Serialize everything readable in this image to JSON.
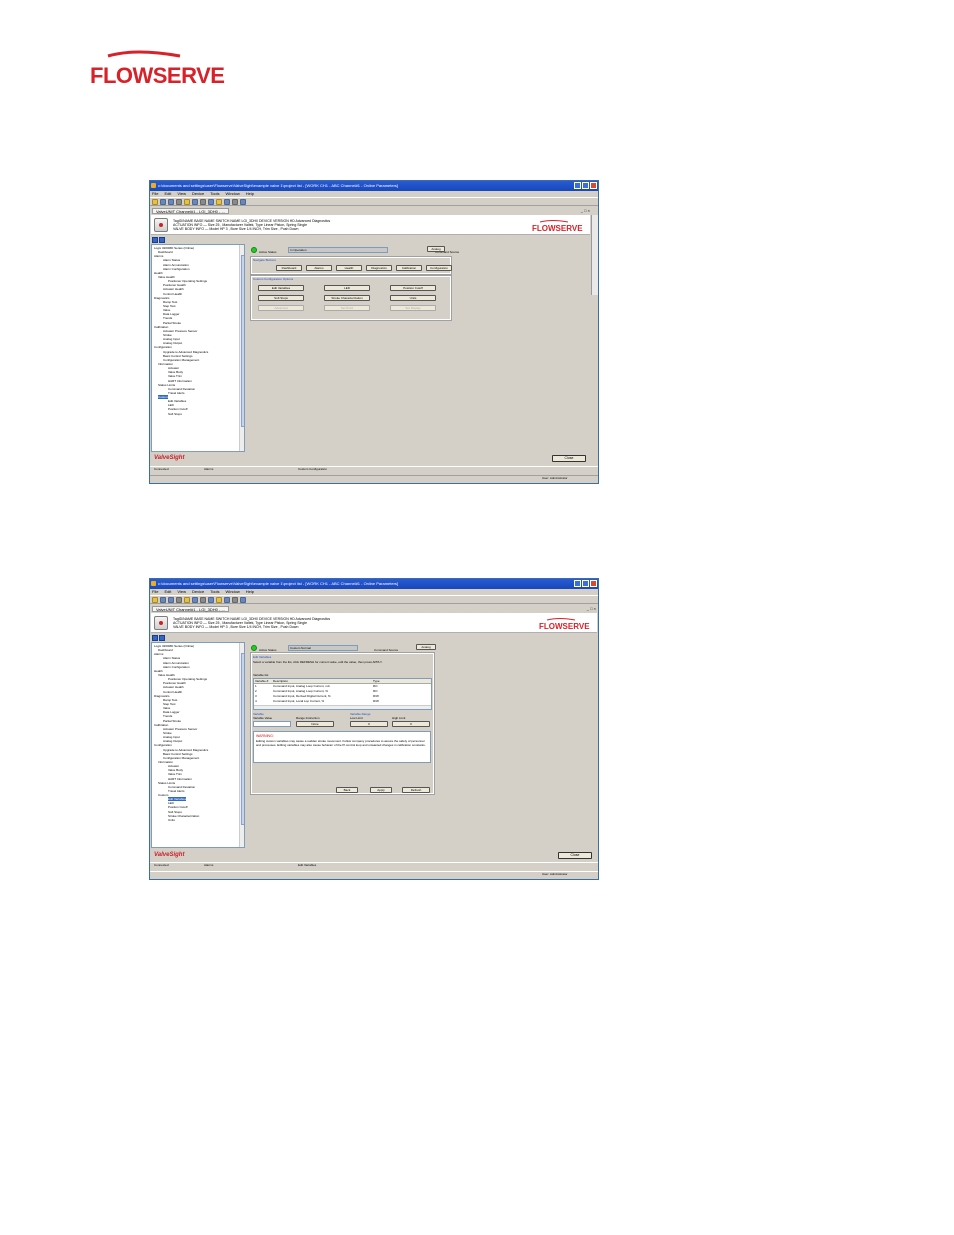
{
  "brand": {
    "logo_text": "FLOWSERVE",
    "logo_color": "#d7222a",
    "app_brand": "ValveSight"
  },
  "app": {
    "title": "c:\\documents and settings\\user\\Flowserve\\ValveSight\\example valve 1\\project list - [WORK CH1 - ABC Channel#1 - Online Parameters]",
    "menus": [
      "File",
      "Edit",
      "View",
      "Device",
      "Tools",
      "Window",
      "Help"
    ],
    "doc_tab": "ValveUNIT Channel#1 - LGI_3DH0 - ...",
    "mdi_controls": "_ □ ×",
    "info_lines": [
      "TagID/NAME   BASE NAME  SWITCH NAME  LGI_3DH0       DEVICE VERSION   HD Advanced Diagnostics",
      "ACTUATION INFO  —  Size 25 , Manufacturer Valtek, Type Linear Piston, Spring Single",
      "VALVE BODY INFO  —  Model HP 3 , Bore Size 1/4 INCH, Trim Size , Push Down"
    ],
    "close_label": "Close",
    "status_connected": "Connected",
    "status_alarms": "Alarms",
    "status_user": "User: Administrator"
  },
  "screen1": {
    "tree": [
      {
        "label": "Logix 3200MD Series (Online)",
        "level": 0
      },
      {
        "label": "Dashboard",
        "level": 1
      },
      {
        "label": "Alarms",
        "level": 0
      },
      {
        "label": "Alarm Status",
        "level": 2
      },
      {
        "label": "Alarm Annunciation",
        "level": 2
      },
      {
        "label": "Alarm Configuration",
        "level": 2
      },
      {
        "label": "Health",
        "level": 0
      },
      {
        "label": "Valve Health",
        "level": 1
      },
      {
        "label": "Positioner Operating Settings",
        "level": 3
      },
      {
        "label": "Positioner Health",
        "level": 2
      },
      {
        "label": "Actuator Health",
        "level": 2
      },
      {
        "label": "Control Health",
        "level": 2
      },
      {
        "label": "Diagnostics",
        "level": 0
      },
      {
        "label": "Ramp Test",
        "level": 2
      },
      {
        "label": "Step Test",
        "level": 2
      },
      {
        "label": "Valve",
        "level": 2
      },
      {
        "label": "Data Logger",
        "level": 2
      },
      {
        "label": "Trends",
        "level": 2
      },
      {
        "label": "Partial Stroke",
        "level": 2
      },
      {
        "label": "Calibration",
        "level": 0
      },
      {
        "label": "Actuator Pressure Sensor",
        "level": 2
      },
      {
        "label": "Stroke",
        "level": 2
      },
      {
        "label": "Analog Input",
        "level": 2
      },
      {
        "label": "Analog Output",
        "level": 2
      },
      {
        "label": "Configuration",
        "level": 0
      },
      {
        "label": "Upgrade to Advanced Diagnostics",
        "level": 2
      },
      {
        "label": "Basic Control Settings",
        "level": 2
      },
      {
        "label": "Configuration Management",
        "level": 2
      },
      {
        "label": "Information",
        "level": 1
      },
      {
        "label": "Actuator",
        "level": 3
      },
      {
        "label": "Valve Body",
        "level": 3
      },
      {
        "label": "Valve Trim",
        "level": 3
      },
      {
        "label": "HART Information",
        "level": 3
      },
      {
        "label": "Status Limits",
        "level": 1
      },
      {
        "label": "Command Deviation",
        "level": 3
      },
      {
        "label": "Travel Alerts",
        "level": 3
      },
      {
        "label": "Custom",
        "level": 1,
        "selected": true
      },
      {
        "label": "Edit Variables",
        "level": 3
      },
      {
        "label": "LED",
        "level": 3
      },
      {
        "label": "Position Cutoff",
        "level": 3
      },
      {
        "label": "Soft Stops",
        "level": 3
      }
    ],
    "active_status_label": "Active Status",
    "active_status_value": "In Operation",
    "command_source_label": "Command Source",
    "command_source_value": "Analog",
    "nav_title": "Navigate Buttons",
    "nav_buttons": [
      "Dashboard",
      "Alarms",
      "Health",
      "Diagnostics",
      "Calibration",
      "Configuration"
    ],
    "custom_title": "Custom Configuration Options",
    "custom_buttons": [
      "Edit Variables",
      "LED",
      "Position Cutoff",
      "Soft Stops",
      "Stroke Characterization",
      "Units",
      "Advanced",
      "Set Point",
      "Set Display"
    ],
    "status_page": "Custom Configuration"
  },
  "screen2": {
    "tree": [
      {
        "label": "Logix 3200MD Series (Online)",
        "level": 0
      },
      {
        "label": "Dashboard",
        "level": 1
      },
      {
        "label": "Alarms",
        "level": 0
      },
      {
        "label": "Alarm Status",
        "level": 2
      },
      {
        "label": "Alarm Annunciation",
        "level": 2
      },
      {
        "label": "Alarm Configuration",
        "level": 2
      },
      {
        "label": "Health",
        "level": 0
      },
      {
        "label": "Valve Health",
        "level": 1
      },
      {
        "label": "Positioner Operating Settings",
        "level": 3
      },
      {
        "label": "Positioner Health",
        "level": 2
      },
      {
        "label": "Actuator Health",
        "level": 2
      },
      {
        "label": "Control Health",
        "level": 2
      },
      {
        "label": "Diagnostics",
        "level": 0
      },
      {
        "label": "Ramp Test",
        "level": 2
      },
      {
        "label": "Step Test",
        "level": 2
      },
      {
        "label": "Valve",
        "level": 2
      },
      {
        "label": "Data Logger",
        "level": 2
      },
      {
        "label": "Trends",
        "level": 2
      },
      {
        "label": "Partial Stroke",
        "level": 2
      },
      {
        "label": "Calibration",
        "level": 0
      },
      {
        "label": "Actuator Pressure Sensor",
        "level": 2
      },
      {
        "label": "Stroke",
        "level": 2
      },
      {
        "label": "Analog Input",
        "level": 2
      },
      {
        "label": "Analog Output",
        "level": 2
      },
      {
        "label": "Configuration",
        "level": 0
      },
      {
        "label": "Upgrade to Advanced Diagnostics",
        "level": 2
      },
      {
        "label": "Basic Control Settings",
        "level": 2
      },
      {
        "label": "Configuration Management",
        "level": 2
      },
      {
        "label": "Information",
        "level": 1
      },
      {
        "label": "Actuator",
        "level": 3
      },
      {
        "label": "Valve Body",
        "level": 3
      },
      {
        "label": "Valve Trim",
        "level": 3
      },
      {
        "label": "HART Information",
        "level": 3
      },
      {
        "label": "Status Limits",
        "level": 1
      },
      {
        "label": "Command Deviation",
        "level": 3
      },
      {
        "label": "Travel Alerts",
        "level": 3
      },
      {
        "label": "Custom",
        "level": 1
      },
      {
        "label": "Edit Variables",
        "level": 3,
        "selected": true
      },
      {
        "label": "LED",
        "level": 3
      },
      {
        "label": "Position Cutoff",
        "level": 3
      },
      {
        "label": "Soft Stops",
        "level": 3
      },
      {
        "label": "Stroke Characterization",
        "level": 3
      },
      {
        "label": "Units",
        "level": 3
      }
    ],
    "active_status_label": "Active Status",
    "active_status_value": "Custom Normal",
    "command_source_label": "Command Source",
    "command_source_value": "Analog",
    "section_title": "Edit Variables",
    "instructions": "Select a variable from the list, click REFRESH for current value, edit the value, then press APPLY.",
    "variable_list_label": "Variable list",
    "table_headers": [
      "Variable #",
      "Description",
      "Type"
    ],
    "table_rows": [
      [
        "1",
        "Command Input, Analog Loop Current, mA",
        "RO"
      ],
      [
        "2",
        "Command Input, Analog Loop Current, %",
        "RO"
      ],
      [
        "3",
        "Command Input, Derived Digital Current, %",
        "R/W"
      ],
      [
        "4",
        "Command Input, Local Lop Current, %",
        "R/W"
      ]
    ],
    "variable_label": "Variable",
    "variable_value_label": "Variable Value",
    "range_instruction_label": "Range Instruction",
    "range_value": "None",
    "range_title": "Variable Range",
    "low_limit_label": "Low Limit",
    "low_limit_value": "0",
    "high_limit_label": "High Limit",
    "high_limit_value": "0",
    "warning_title": "WARNING:",
    "warning_text": "Editing custom variables may cause a sudden stroke movement. Follow company procedures to assure the safety of personnel and processes. Editing variables may also cause behavior of the Pt control loop and unwanted changes in calibration constants.",
    "back_label": "Back",
    "apply_label": "Apply",
    "refresh_label": "Refresh",
    "status_page": "Edit Variables"
  }
}
